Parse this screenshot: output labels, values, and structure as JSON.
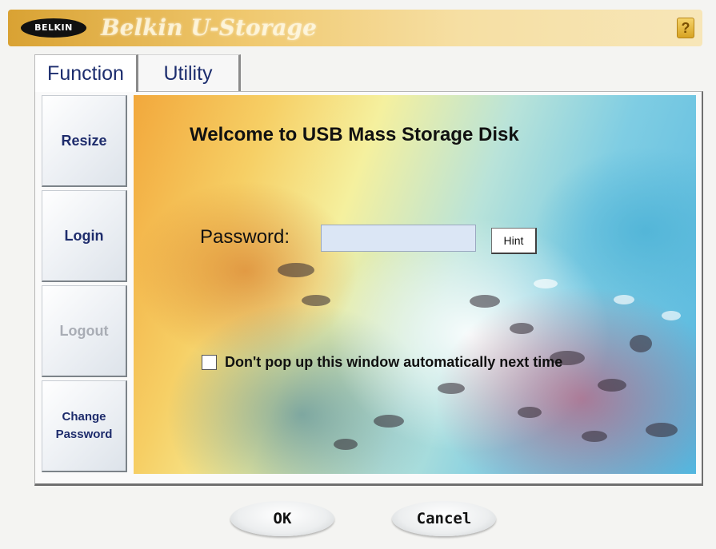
{
  "titlebar": {
    "logo_text": "BELKIN",
    "app_title": "Belkin U-Storage",
    "help_glyph": "?"
  },
  "tabs": [
    {
      "label": "Function",
      "active": true
    },
    {
      "label": "Utility",
      "active": false
    }
  ],
  "sidebar": {
    "items": [
      {
        "label": "Resize",
        "enabled": true
      },
      {
        "label": "Login",
        "enabled": true
      },
      {
        "label": "Logout",
        "enabled": false
      },
      {
        "label_line1": "Change",
        "label_line2": "Password",
        "enabled": true
      }
    ]
  },
  "main": {
    "welcome": "Welcome to USB Mass Storage Disk",
    "password_label": "Password:",
    "password_value": "",
    "hint_label": "Hint",
    "checkbox_label": "Don't pop up this window automatically next time",
    "checkbox_checked": false
  },
  "buttons": {
    "ok_label": "OK",
    "cancel_label": "Cancel"
  },
  "colors": {
    "titlebar_gold": "#d9a233",
    "tab_text": "#1c2d6e",
    "disabled_text": "#a9adb5"
  }
}
